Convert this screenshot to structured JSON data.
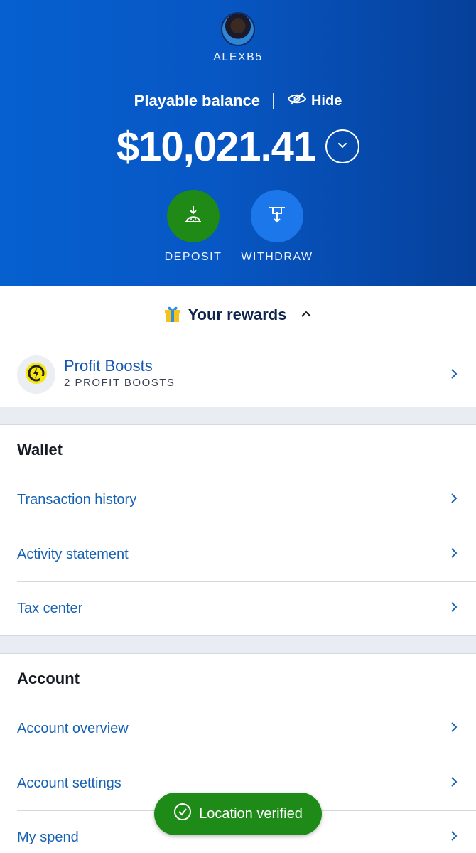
{
  "header": {
    "username": "ALEXB5",
    "balance_label": "Playable balance",
    "hide_label": "Hide",
    "balance_amount": "$10,021.41",
    "deposit_label": "DEPOSIT",
    "withdraw_label": "WITHDRAW"
  },
  "rewards": {
    "title": "Your rewards",
    "profit_boosts": {
      "title": "Profit Boosts",
      "subtitle": "2 PROFIT BOOSTS"
    }
  },
  "wallet": {
    "title": "Wallet",
    "items": [
      {
        "label": "Transaction history"
      },
      {
        "label": "Activity statement"
      },
      {
        "label": "Tax center"
      }
    ]
  },
  "account": {
    "title": "Account",
    "items": [
      {
        "label": "Account overview"
      },
      {
        "label": "Account settings"
      },
      {
        "label": "My spend"
      }
    ]
  },
  "toast": {
    "label": "Location verified"
  },
  "colors": {
    "hero_blue": "#0660cf",
    "deposit_green": "#1f8a15",
    "withdraw_blue": "#1c77ea",
    "link_blue": "#1561b5",
    "toast_green": "#1e8a17"
  },
  "icons": [
    "avatar",
    "eye-off-icon",
    "chevron-down-icon",
    "deposit-icon",
    "withdraw-icon",
    "gift-icon",
    "chevron-up-icon",
    "profit-boost-icon",
    "chevron-right-icon",
    "check-circle-icon"
  ]
}
